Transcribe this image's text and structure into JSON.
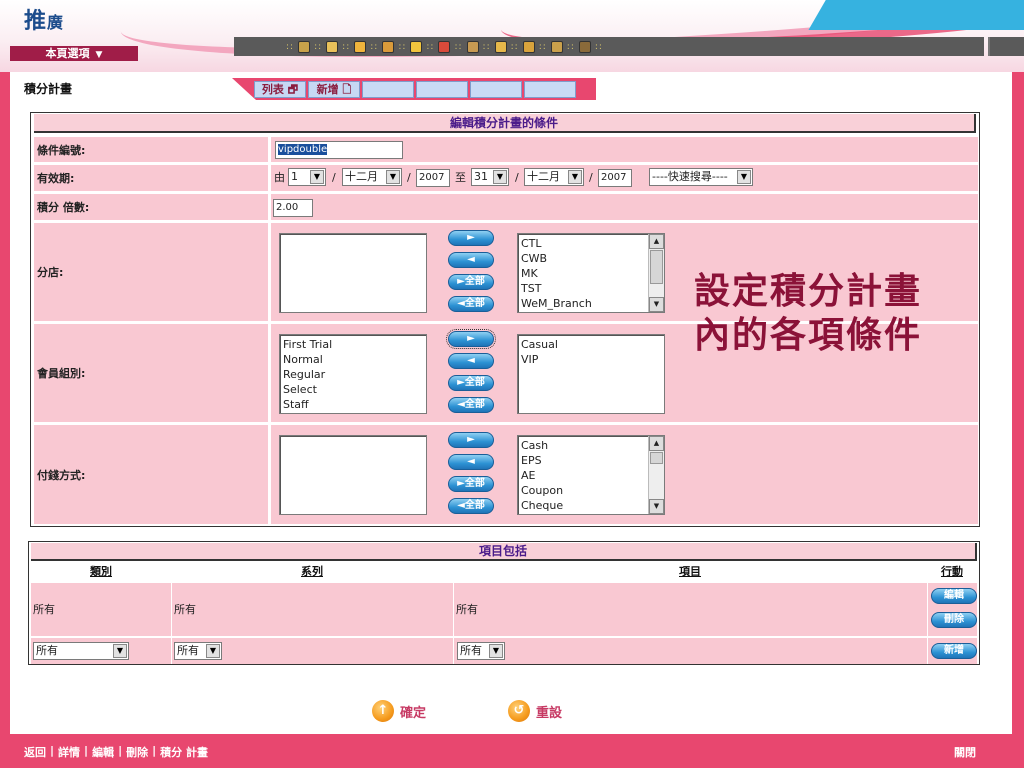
{
  "header": {
    "logo_main": "推",
    "logo_small": "廣",
    "page_menu_label": "本頁選項",
    "toolbar_separator": "::",
    "toolbar_icons": [
      "coins-icon",
      "people-icon",
      "clock-icon",
      "calendar-icon",
      "coin-icon",
      "gift-icon",
      "home-icon",
      "dollar-icon",
      "calculator-icon",
      "clipboard-icon",
      "users-icon"
    ]
  },
  "page": {
    "title": "積分計畫",
    "tabs": [
      {
        "label": "列表 🗗"
      },
      {
        "label": "新增 🗋"
      },
      {
        "label": ""
      },
      {
        "label": ""
      },
      {
        "label": ""
      },
      {
        "label": ""
      }
    ]
  },
  "form": {
    "header": "編輯積分計畫的條件",
    "condition_id": {
      "label": "條件編號:",
      "value": "vipdouble"
    },
    "validity": {
      "label": "有效期:",
      "from_text": "由",
      "to_text": "至",
      "slash": "/",
      "start_day": "1",
      "start_month": "十二月",
      "start_year": "2007",
      "end_day": "31",
      "end_month": "十二月",
      "end_year": "2007",
      "quick_search": "----快速搜尋----"
    },
    "multiplier": {
      "label": "積分 倍數:",
      "value": "2.00"
    },
    "branch": {
      "label": "分店:",
      "selected": [],
      "available": [
        "CTL",
        "CWB",
        "MK",
        "TST",
        "WeM_Branch"
      ]
    },
    "member_group": {
      "label": "會員組別:",
      "selected": [
        "First Trial",
        "Normal",
        "Regular",
        "Select",
        "Staff"
      ],
      "available": [
        "Casual",
        "VIP"
      ]
    },
    "payment": {
      "label": "付錢方式:",
      "selected": [],
      "available": [
        "Cash",
        "EPS",
        "AE",
        "Coupon",
        "Cheque"
      ]
    },
    "transfer_buttons": {
      "add": "►",
      "remove": "◄",
      "add_all": "►全部",
      "remove_all": "◄全部"
    }
  },
  "callout": {
    "line1": "設定積分計畫",
    "line2": "內的各項條件"
  },
  "items": {
    "header": "項目包括",
    "columns": [
      "類別",
      "系列",
      "項目",
      "行動"
    ],
    "row": {
      "category": "所有",
      "series": "所有",
      "item": "所有"
    },
    "row_buttons": {
      "edit": "編輯",
      "delete": "刪除"
    },
    "new_row": {
      "category": "所有",
      "series": "所有",
      "item": "所有",
      "add_button": "新增"
    }
  },
  "actions": {
    "confirm": "確定",
    "reset": "重設"
  },
  "footer": {
    "links": [
      "返回",
      "詳情",
      "編輯",
      "刪除",
      "積分 計畫"
    ],
    "close": "關閉"
  },
  "colors": {
    "brand_pink": "#e8476f",
    "panel_pink": "#f9c8d2",
    "header_purple": "#4a1b8a",
    "callout_maroon": "#8b1238",
    "button_blue": "#2d92d4"
  }
}
